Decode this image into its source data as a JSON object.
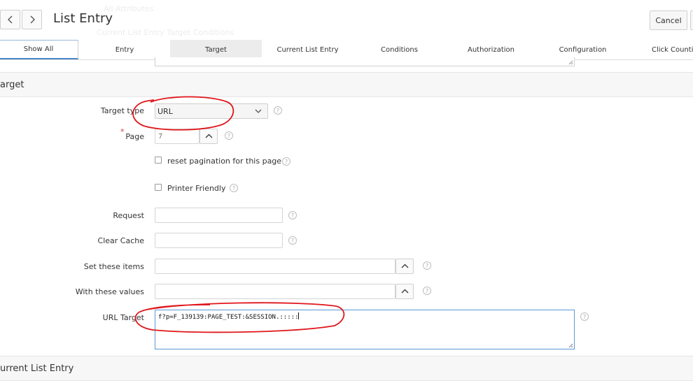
{
  "header": {
    "title": "List Entry",
    "cancel_label": "Cancel",
    "ghost_text_1": "All Attributes",
    "ghost_text_2": "Current List Entry     Target     Conditions"
  },
  "tabs": [
    {
      "label": "Show All"
    },
    {
      "label": "Entry"
    },
    {
      "label": "Target"
    },
    {
      "label": "Current List Entry"
    },
    {
      "label": "Conditions"
    },
    {
      "label": "Authorization"
    },
    {
      "label": "Configuration"
    },
    {
      "label": "Click Counting"
    }
  ],
  "sections": {
    "target_title": "arget",
    "current_title": "urrent List Entry"
  },
  "form": {
    "target_type": {
      "label": "Target type",
      "value": "URL"
    },
    "page": {
      "label": "Page",
      "required_mark": "*",
      "value": "7"
    },
    "reset_pagination": {
      "label": "reset pagination for this page",
      "checked": false
    },
    "printer_friendly": {
      "label": "Printer Friendly",
      "checked": false
    },
    "request": {
      "label": "Request",
      "value": ""
    },
    "clear_cache": {
      "label": "Clear Cache",
      "value": ""
    },
    "set_items": {
      "label": "Set these items",
      "value": ""
    },
    "with_values": {
      "label": "With these values",
      "value": ""
    },
    "url_target": {
      "label": "URL Target",
      "value": "f?p=F_139139:PAGE_TEST:&SESSION.:::::"
    }
  },
  "annotations": {
    "circle_color": "#e0161b"
  },
  "colors": {
    "accent": "#4a88c8",
    "required": "#d63b3b"
  }
}
